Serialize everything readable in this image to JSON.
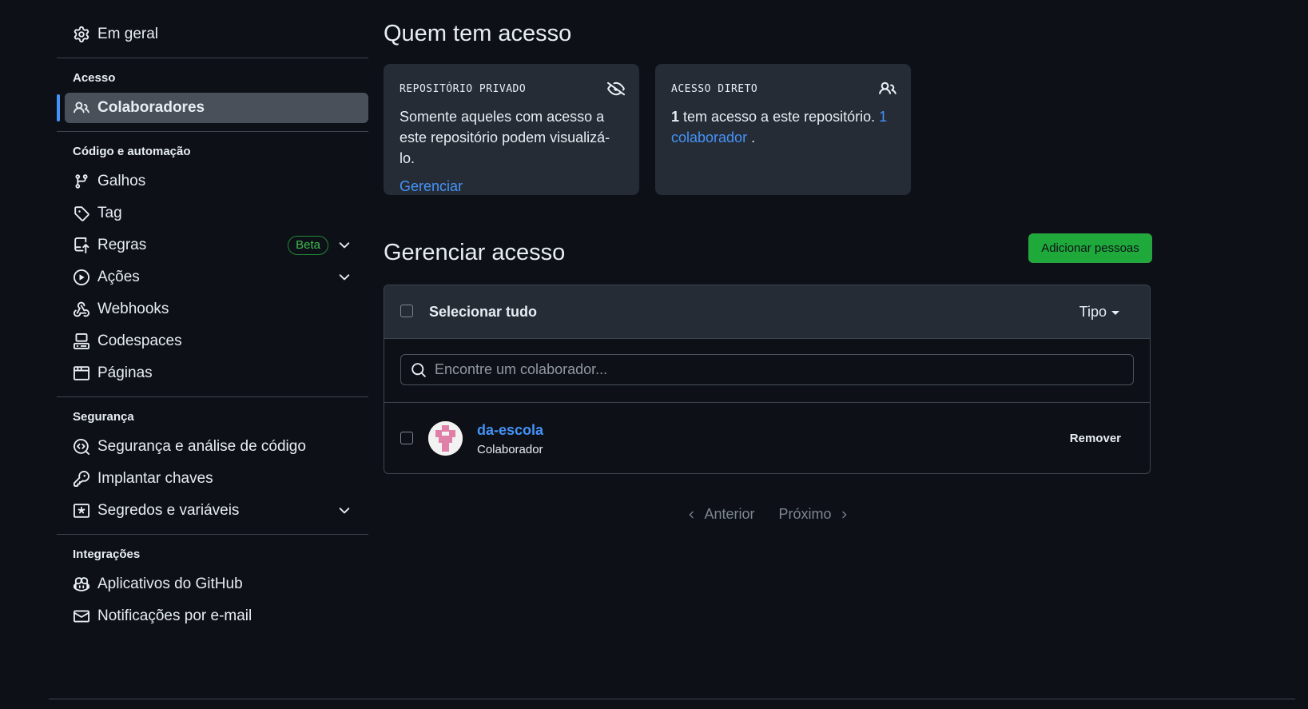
{
  "sidebar": {
    "general": "Em geral",
    "sections": [
      {
        "heading": "Acesso"
      },
      {
        "heading": "Código e automação"
      },
      {
        "heading": "Segurança"
      },
      {
        "heading": "Integrações"
      }
    ],
    "items": {
      "colaboradores": "Colaboradores",
      "galhos": "Galhos",
      "tag": "Tag",
      "regras": "Regras",
      "regras_badge": "Beta",
      "acoes": "Ações",
      "webhooks": "Webhooks",
      "codespaces": "Codespaces",
      "paginas": "Páginas",
      "seguranca_analise": "Segurança e análise de código",
      "implantar_chaves": "Implantar chaves",
      "segredos": "Segredos e variáveis",
      "aplicativos": "Aplicativos do GitHub",
      "notificacoes": "Notificações por e-mail"
    }
  },
  "main": {
    "title": "Quem tem acesso",
    "private_card": {
      "label": "REPOSITÓRIO PRIVADO",
      "text": "Somente aqueles com acesso a este repositório podem visualizá-lo.",
      "link": "Gerenciar",
      "icon": "eye-closed-icon"
    },
    "direct_card": {
      "label": "ACESSO DIRETO",
      "count": "1",
      "text": " tem acesso a este repositório. ",
      "link": "1 colaborador",
      "tail": " .",
      "icon": "people-icon"
    },
    "manage_title": "Gerenciar acesso",
    "add_button": "Adicionar pessoas",
    "select_all": "Selecionar tudo",
    "type_filter": "Tipo",
    "search_placeholder": "Encontre um colaborador...",
    "members": [
      {
        "name": "da-escola",
        "role": "Colaborador",
        "action": "Remover"
      }
    ],
    "pagination": {
      "prev": "Anterior",
      "next": "Próximo"
    }
  },
  "colors": {
    "accent_blue": "#4493f8",
    "success_green": "#1fa93b",
    "background": "#0d1117",
    "card_bg": "#262c36"
  }
}
